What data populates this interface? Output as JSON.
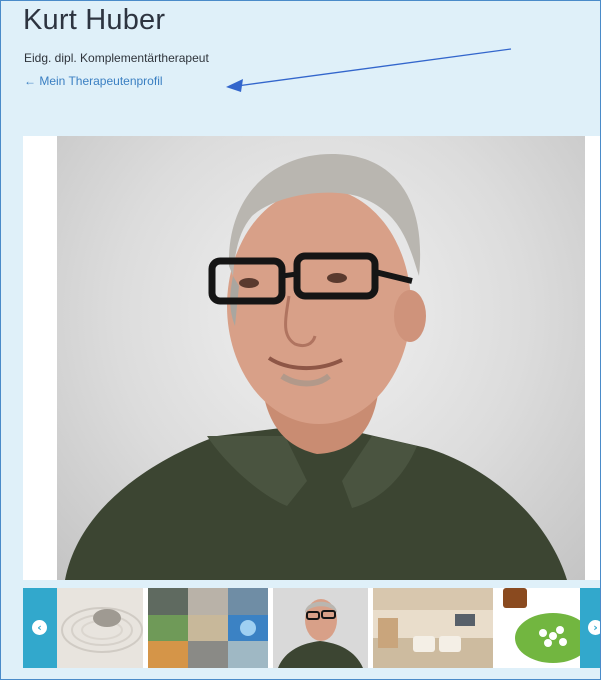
{
  "therapist": {
    "name": "Kurt Huber",
    "title": "Eidg. dipl. Komplementärtherapeut",
    "profile_link": "← Mein Therapeutenprofil"
  },
  "annotation": {
    "arrow_color": "#3366cc"
  },
  "gallery": {
    "main_photo": "portrait of man with glasses and dark green polo shirt",
    "thumbnails": [
      {
        "subject": "zen sand garden with stone"
      },
      {
        "subject": "spa collage with stones and water"
      },
      {
        "subject": "portrait thumbnail"
      },
      {
        "subject": "therapy room interior"
      },
      {
        "subject": "homeopathic globules on leaf"
      }
    ],
    "prev_icon": "chevron-left-icon",
    "next_icon": "chevron-right-icon",
    "nav_color": "#32a8cc"
  },
  "colors": {
    "background": "#dff0f9",
    "border": "#4a8bc9",
    "link": "#3a7fc2",
    "heading": "#2d3440"
  }
}
